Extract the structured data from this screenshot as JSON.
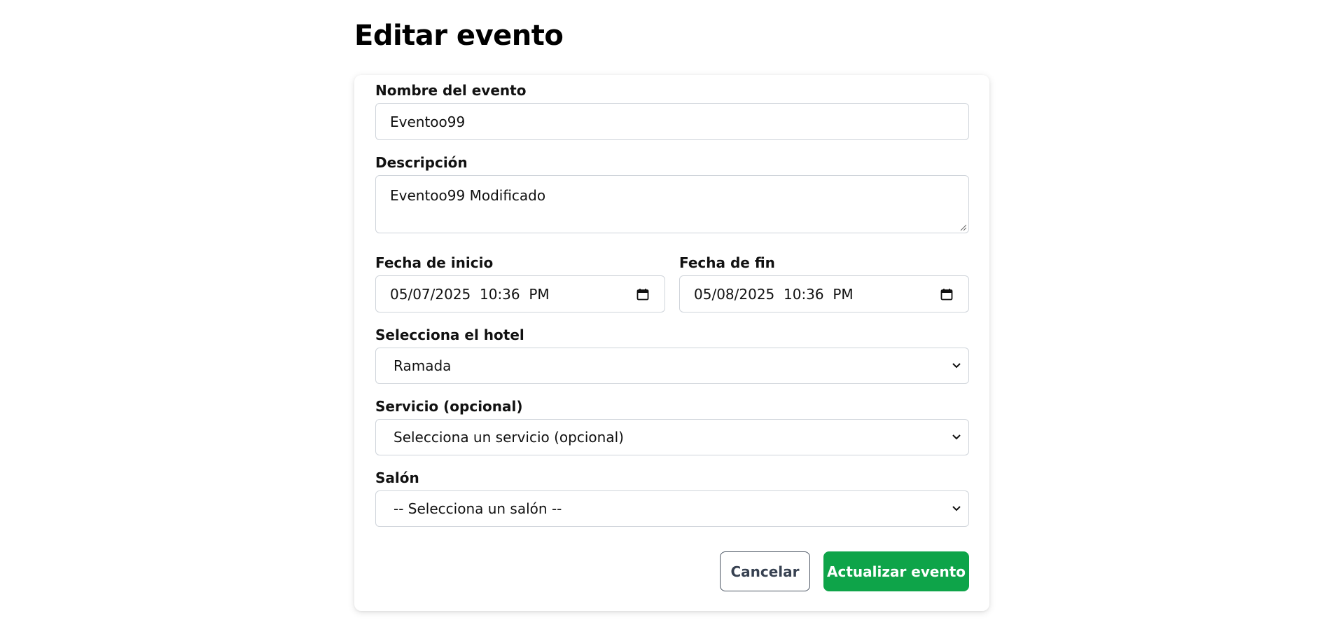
{
  "page": {
    "title": "Editar evento"
  },
  "form": {
    "name": {
      "label": "Nombre del evento",
      "value": "Eventoo99"
    },
    "description": {
      "label": "Descripción",
      "value": "Eventoo99 Modificado"
    },
    "start_date": {
      "label": "Fecha de inicio",
      "value": "05/07/2025  10:36  PM"
    },
    "end_date": {
      "label": "Fecha de fin",
      "value": "05/08/2025  10:36  PM"
    },
    "hotel": {
      "label": "Selecciona el hotel",
      "selected": "Ramada"
    },
    "service": {
      "label": "Servicio (opcional)",
      "selected": "Selecciona un servicio (opcional)"
    },
    "salon": {
      "label": "Salón",
      "selected": "-- Selecciona un salón --"
    }
  },
  "actions": {
    "cancel_label": "Cancelar",
    "submit_label": "Actualizar evento"
  },
  "icons": {
    "date_picker": "calendar-icon",
    "select_arrow": "chevron-down-icon",
    "textarea_resize": "resize-grip-icon"
  },
  "colors": {
    "primary_button": "#0ea449",
    "cancel_border": "#4b5563",
    "input_border": "#cfd4da"
  }
}
